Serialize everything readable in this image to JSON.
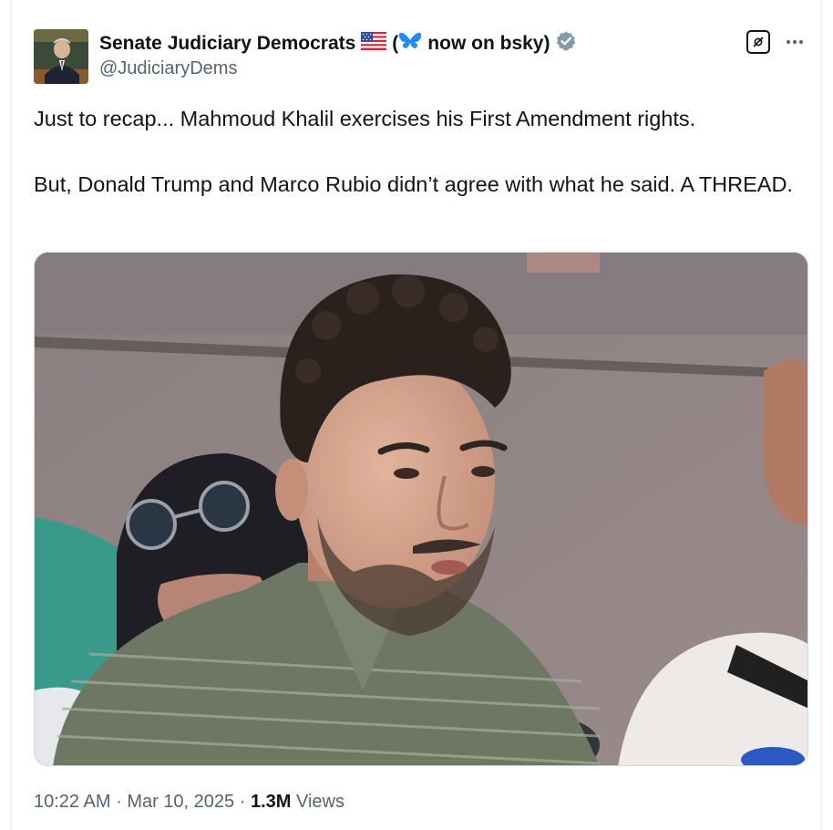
{
  "author": {
    "display_name": "Senate Judiciary Democrats",
    "flag_icon": "us-flag-icon",
    "bio_suffix_open": "(",
    "butterfly_icon": "bluesky-butterfly-icon",
    "bio_suffix_text": "now on bsky)",
    "verified_icon": "verified-badge-icon",
    "verified_color": "#829aab",
    "handle": "@JudiciaryDems"
  },
  "tweet": {
    "paragraphs": [
      "Just to recap... Mahmoud Khalil exercises his First Amendment rights.",
      "But, Donald Trump and Marco Rubio didn’t agree with what he said. A THREAD."
    ]
  },
  "actions": {
    "grok_icon": "grok-icon",
    "more_icon": "more-options-icon"
  },
  "meta": {
    "time": "10:22 AM",
    "separator": "·",
    "date": "Mar 10, 2025",
    "views_count": "1.3M",
    "views_label": "Views"
  },
  "colors": {
    "text": "#0f1419",
    "secondary": "#536471",
    "border": "#cfd9de"
  }
}
